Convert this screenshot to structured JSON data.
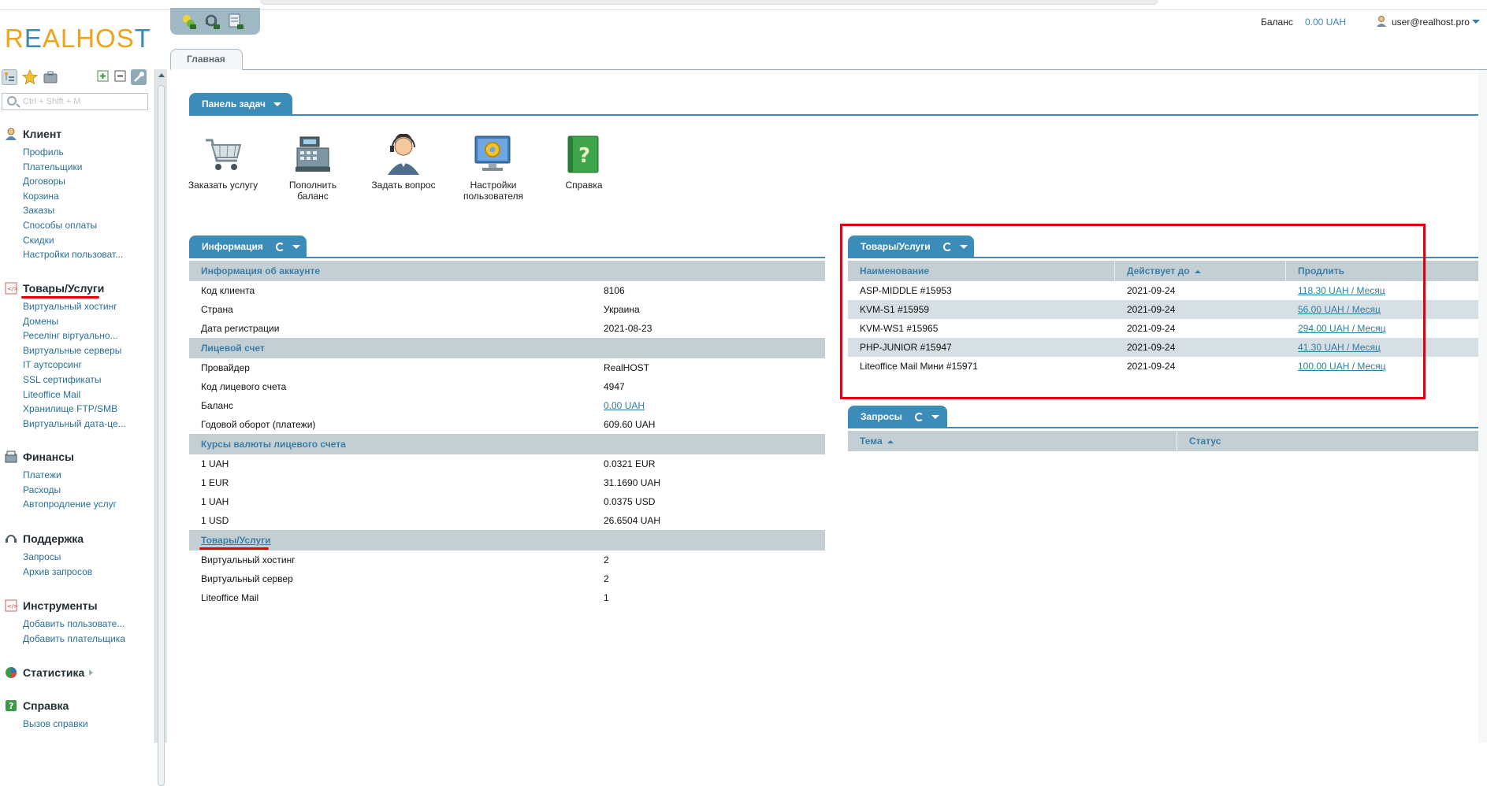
{
  "header": {
    "logo_text": "REALHOST",
    "balance_label": "Баланс",
    "balance_value": "0.00 UAH",
    "user_name": "user@realhost.pro"
  },
  "quickbar": {
    "icons": [
      "add-order-icon",
      "support-icon",
      "billing-icon"
    ]
  },
  "sidebar": {
    "search_placeholder": "Ctrl + Shift + M",
    "groups": [
      {
        "title": "Клиент",
        "icon": "client-icon",
        "items": [
          "Профиль",
          "Плательщики",
          "Договоры",
          "Корзина",
          "Заказы",
          "Способы оплаты",
          "Скидки",
          "Настройки пользоват..."
        ]
      },
      {
        "title": "Товары/Услуги",
        "icon": "services-icon",
        "items": [
          "Виртуальный хостинг",
          "Домены",
          "Реселінг віртуально...",
          "Виртуальные серверы",
          "IT аутсорсинг",
          "SSL сертификаты",
          "Liteoffice Mail",
          "Хранилище FTP/SMB",
          "Виртуальный дата-це..."
        ]
      },
      {
        "title": "Финансы",
        "icon": "finance-icon",
        "items": [
          "Платежи",
          "Расходы",
          "Автопродление услуг"
        ]
      },
      {
        "title": "Поддержка",
        "icon": "support-icon",
        "items": [
          "Запросы",
          "Архив запросов"
        ]
      },
      {
        "title": "Инструменты",
        "icon": "tools-icon",
        "items": [
          "Добавить пользовате...",
          "Добавить плательщика"
        ]
      },
      {
        "title": "Статистика",
        "icon": "statistics-icon",
        "items": []
      },
      {
        "title": "Справка",
        "icon": "help-icon",
        "items": [
          "Вызов справки"
        ]
      }
    ]
  },
  "main_tab": "Главная",
  "task_panel": {
    "title": "Панель задач",
    "tasks": [
      {
        "label": "Заказать услугу",
        "icon": "cart-icon"
      },
      {
        "label": "Пополнить баланс",
        "icon": "cash-register-icon"
      },
      {
        "label": "Задать вопрос",
        "icon": "operator-icon"
      },
      {
        "label": "Настройки пользователя",
        "icon": "settings-monitor-icon"
      },
      {
        "label": "Справка",
        "icon": "help-book-icon"
      }
    ]
  },
  "info_panel": {
    "title": "Информация",
    "sections": [
      {
        "title": "Информация об аккаунте",
        "rows": [
          {
            "label": "Код клиента",
            "value": "8106"
          },
          {
            "label": "Страна",
            "value": "Украина"
          },
          {
            "label": "Дата регистрации",
            "value": "2021-08-23"
          }
        ]
      },
      {
        "title": "Лицевой счет",
        "rows": [
          {
            "label": "Провайдер",
            "value": "RealHOST"
          },
          {
            "label": "Код лицевого счета",
            "value": "4947"
          },
          {
            "label": "Баланс",
            "value": "0.00 UAH",
            "link": true
          },
          {
            "label": "Годовой оборот (платежи)",
            "value": "609.60 UAH"
          }
        ]
      },
      {
        "title": "Курсы валюты лицевого счета",
        "rows": [
          {
            "label": "1 UAH",
            "value": "0.0321 EUR"
          },
          {
            "label": "1 EUR",
            "value": "31.1690 UAH"
          },
          {
            "label": "1 UAH",
            "value": "0.0375 USD"
          },
          {
            "label": "1 USD",
            "value": "26.6504 UAH"
          }
        ]
      },
      {
        "title": "Товары/Услуги",
        "title_link": true,
        "rows": [
          {
            "label": "Виртуальный хостинг",
            "value": "2"
          },
          {
            "label": "Виртуальный сервер",
            "value": "2"
          },
          {
            "label": "Liteoffice Mail",
            "value": "1"
          }
        ]
      }
    ]
  },
  "goods_panel": {
    "title": "Товары/Услуги",
    "columns": [
      "Наименование",
      "Действует до",
      "Продлить"
    ],
    "rows": [
      {
        "name": "ASP-MIDDLE #15953",
        "until": "2021-09-24",
        "renew": "118.30 UAH / Месяц"
      },
      {
        "name": "KVM-S1 #15959",
        "until": "2021-09-24",
        "renew": "56.00 UAH / Месяц"
      },
      {
        "name": "KVM-WS1 #15965",
        "until": "2021-09-24",
        "renew": "294.00 UAH / Месяц"
      },
      {
        "name": "PHP-JUNIOR #15947",
        "until": "2021-09-24",
        "renew": "41.30 UAH / Месяц"
      },
      {
        "name": "Liteoffice Mail Мини #15971",
        "until": "2021-09-24",
        "renew": "100.00 UAH / Месяц"
      }
    ]
  },
  "requests_panel": {
    "title": "Запросы",
    "columns": [
      "Тема",
      "Статус"
    ]
  },
  "colors": {
    "accent": "#3b8cb8",
    "section_bg": "#c4cfd4",
    "highlight_red": "#e1000f",
    "logo_orange": "#f0a31a"
  }
}
